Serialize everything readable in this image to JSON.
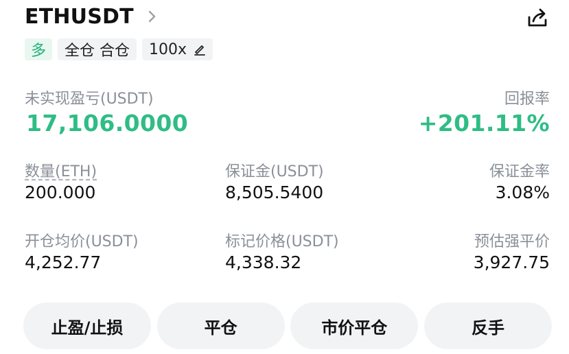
{
  "header": {
    "symbol": "ETHUSDT"
  },
  "tags": {
    "side": "多",
    "margin_mode": "全仓 合仓",
    "leverage": "100x"
  },
  "pnl": {
    "label": "未实现盈亏(USDT)",
    "value": "17,106.0000",
    "roe_label": "回报率",
    "roe_value": "+201.11%"
  },
  "stats": {
    "quantity_label": "数量(ETH)",
    "quantity_value": "200.000",
    "margin_label": "保证金(USDT)",
    "margin_value": "8,505.5400",
    "margin_ratio_label": "保证金率",
    "margin_ratio_value": "3.08%",
    "entry_label": "开仓均价(USDT)",
    "entry_value": "4,252.77",
    "mark_label": "标记价格(USDT)",
    "mark_value": "4,338.32",
    "liq_label": "预估强平价",
    "liq_value": "3,927.75"
  },
  "buttons": {
    "tp_sl": "止盈/止损",
    "close": "平仓",
    "market_close": "市价平仓",
    "reverse": "反手"
  },
  "colors": {
    "profit_green": "#2ebd85",
    "tag_green": "#21b07a",
    "muted_text": "#8a8f98",
    "button_bg": "#f2f3f5"
  },
  "icons": {
    "chevron": "chevron-right-icon",
    "share": "share-icon",
    "edit": "pencil-icon"
  }
}
